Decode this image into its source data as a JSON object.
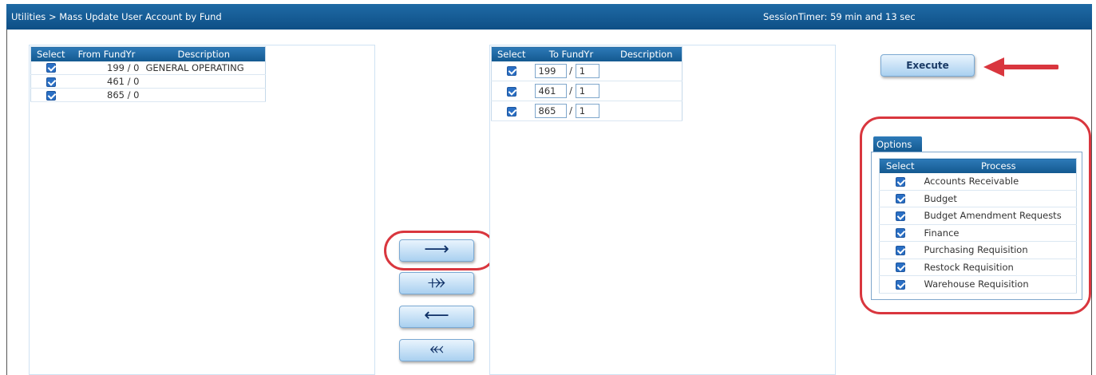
{
  "header": {
    "breadcrumb": "Utilities > Mass Update User Account by Fund",
    "session_timer": "SessionTimer: 59 min and 13 sec"
  },
  "from_grid": {
    "columns": [
      "Select",
      "From FundYr",
      "Description"
    ],
    "rows": [
      {
        "fundyr": "199 / 0",
        "description": "GENERAL OPERATING",
        "checked": true
      },
      {
        "fundyr": "461 / 0",
        "description": "",
        "checked": true
      },
      {
        "fundyr": "865 / 0",
        "description": "",
        "checked": true
      }
    ]
  },
  "to_grid": {
    "columns": [
      "Select",
      "To FundYr",
      "Description"
    ],
    "rows": [
      {
        "fund": "199",
        "separator": "/",
        "year": "1",
        "description": "",
        "checked": true
      },
      {
        "fund": "461",
        "separator": "/",
        "year": "1",
        "description": "",
        "checked": true
      },
      {
        "fund": "865",
        "separator": "/",
        "year": "1",
        "description": "",
        "checked": true
      }
    ]
  },
  "move_buttons": {
    "move_selected": "⟶",
    "move_all": "⤀",
    "remove_selected": "⟵",
    "remove_all": "⬻"
  },
  "execute_label": "Execute",
  "options": {
    "tab_label": "Options",
    "columns": [
      "Select",
      "Process"
    ],
    "items": [
      {
        "label": "Accounts Receivable",
        "checked": true
      },
      {
        "label": "Budget",
        "checked": true
      },
      {
        "label": "Budget Amendment Requests",
        "checked": true
      },
      {
        "label": "Finance",
        "checked": true
      },
      {
        "label": "Purchasing Requisition",
        "checked": true
      },
      {
        "label": "Restock Requisition",
        "checked": true
      },
      {
        "label": "Warehouse Requisition",
        "checked": true
      }
    ]
  },
  "colors": {
    "header_blue": "#13588f",
    "annotation_red": "#d9363e",
    "checkbox_blue": "#2a6fc4"
  }
}
